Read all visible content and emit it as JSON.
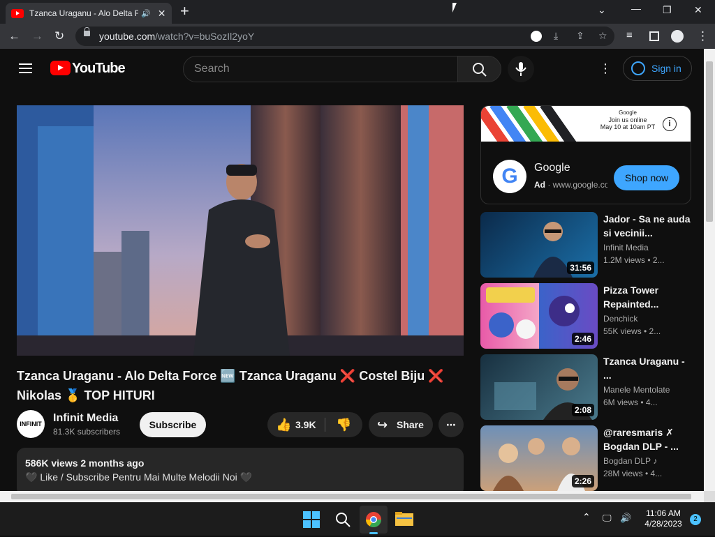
{
  "browser": {
    "tab_title": "Tzanca Uraganu - Alo Delta F",
    "tab_audio_icon": "speaker-icon",
    "url_host": "youtube.com",
    "url_path": "/watch?v=buSozIl2yoY"
  },
  "youtube": {
    "logo_text": "YouTube",
    "search_placeholder": "Search",
    "sign_in_label": "Sign in"
  },
  "video": {
    "title": "Tzanca Uraganu - Alo Delta Force 🆕 Tzanca Uraganu ❌ Costel Biju ❌ Nikolas 🥇 TOP HITURI",
    "channel_name": "Infinit Media",
    "channel_avatar_text": "INFINIT",
    "subscribers": "81.3K subscribers",
    "subscribe_label": "Subscribe",
    "likes": "3.9K",
    "share_label": "Share",
    "views_date": "586K views  2 months ago",
    "description_line": "🖤 Like / Subscribe Pentru Mai Multe Melodii Noi 🖤"
  },
  "ad": {
    "banner_line1": "Google",
    "banner_line2": "Join us online",
    "banner_line3": "May 10 at 10am PT",
    "advertiser": "Google",
    "ad_label": "Ad",
    "ad_url": " · www.google.com",
    "cta": "Shop now",
    "info_symbol": "i"
  },
  "recommendations": [
    {
      "title": "Jador - Sa ne auda si vecinii...",
      "channel": "Infinit Media",
      "views": "1.2M views  • 2...",
      "duration": "31:56",
      "colors": [
        "#0b2a4a",
        "#1b6fa8"
      ]
    },
    {
      "title": "Pizza Tower Repainted...",
      "channel": "Denchick",
      "views": "55K views  • 2...",
      "duration": "2:46",
      "colors": [
        "#e85aa8",
        "#3b63c9"
      ]
    },
    {
      "title": "Tzanca Uraganu - ...",
      "channel": "Manele Mentolate",
      "views": "6M views  • 4...",
      "duration": "2:08",
      "colors": [
        "#183040",
        "#4a7a8c"
      ]
    },
    {
      "title": "@raresmaris ✗ Bogdan DLP - ...",
      "channel": "Bogdan DLP",
      "channel_badge": "♪",
      "views": "28M views  • 4...",
      "duration": "2:26",
      "colors": [
        "#6e90b8",
        "#caa07a"
      ]
    }
  ],
  "taskbar": {
    "time": "11:06 AM",
    "date": "4/28/2023",
    "notifications": "2"
  }
}
